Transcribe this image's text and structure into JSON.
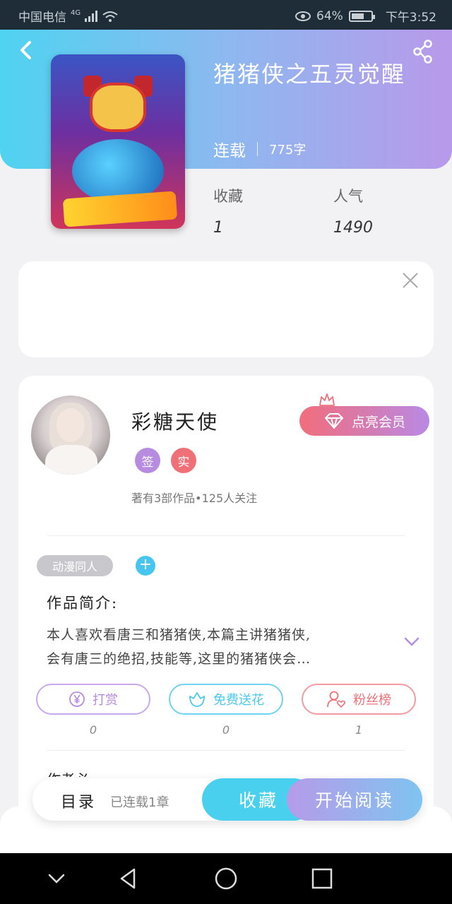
{
  "status_bar": {
    "carrier": "中国电信",
    "network": "4G",
    "battery_text": "64%",
    "battery_level": 0.64,
    "time": "下午3:52"
  },
  "book": {
    "title": "猪猪侠之五灵觉醒",
    "status": "连载",
    "word_count": "775字",
    "collect_label": "收藏",
    "collect_value": "1",
    "popularity_label": "人气",
    "popularity_value": "1490"
  },
  "author": {
    "name": "彩糖天使",
    "vip_label": "点亮会员",
    "badges": [
      "签",
      "实"
    ],
    "meta": "著有3部作品•125人关注"
  },
  "intro": {
    "tag": "动漫同人",
    "tag_add": "+",
    "title": "作品简介:",
    "line1": "本人喜欢看唐三和猪猪侠,本篇主讲猪猪侠,",
    "line2": "会有唐三的绝招,技能等,这里的猪猪侠会…"
  },
  "actions": [
    {
      "label": "打赏",
      "count": "0"
    },
    {
      "label": "免费送花",
      "count": "0"
    },
    {
      "label": "粉丝榜",
      "count": "1"
    }
  ],
  "cut_off_text": "作者必",
  "bottom_bar": {
    "catalog": "目录",
    "serial_status": "已连载1章",
    "favorite": "收藏",
    "start_reading": "开始阅读"
  },
  "colors": {
    "hero_start": "#4fd3f0",
    "hero_end": "#b999ea",
    "accent_blue": "#4ad0ef",
    "tip_purple": "#b78ce0",
    "flower_blue": "#4ac8ee",
    "fans_red": "#f07078"
  },
  "icons": [
    "back-icon",
    "share-icon",
    "close-icon",
    "crown-icon",
    "diamond-icon",
    "yen-icon",
    "flower-icon",
    "user-heart-icon",
    "chevron-down-icon"
  ]
}
